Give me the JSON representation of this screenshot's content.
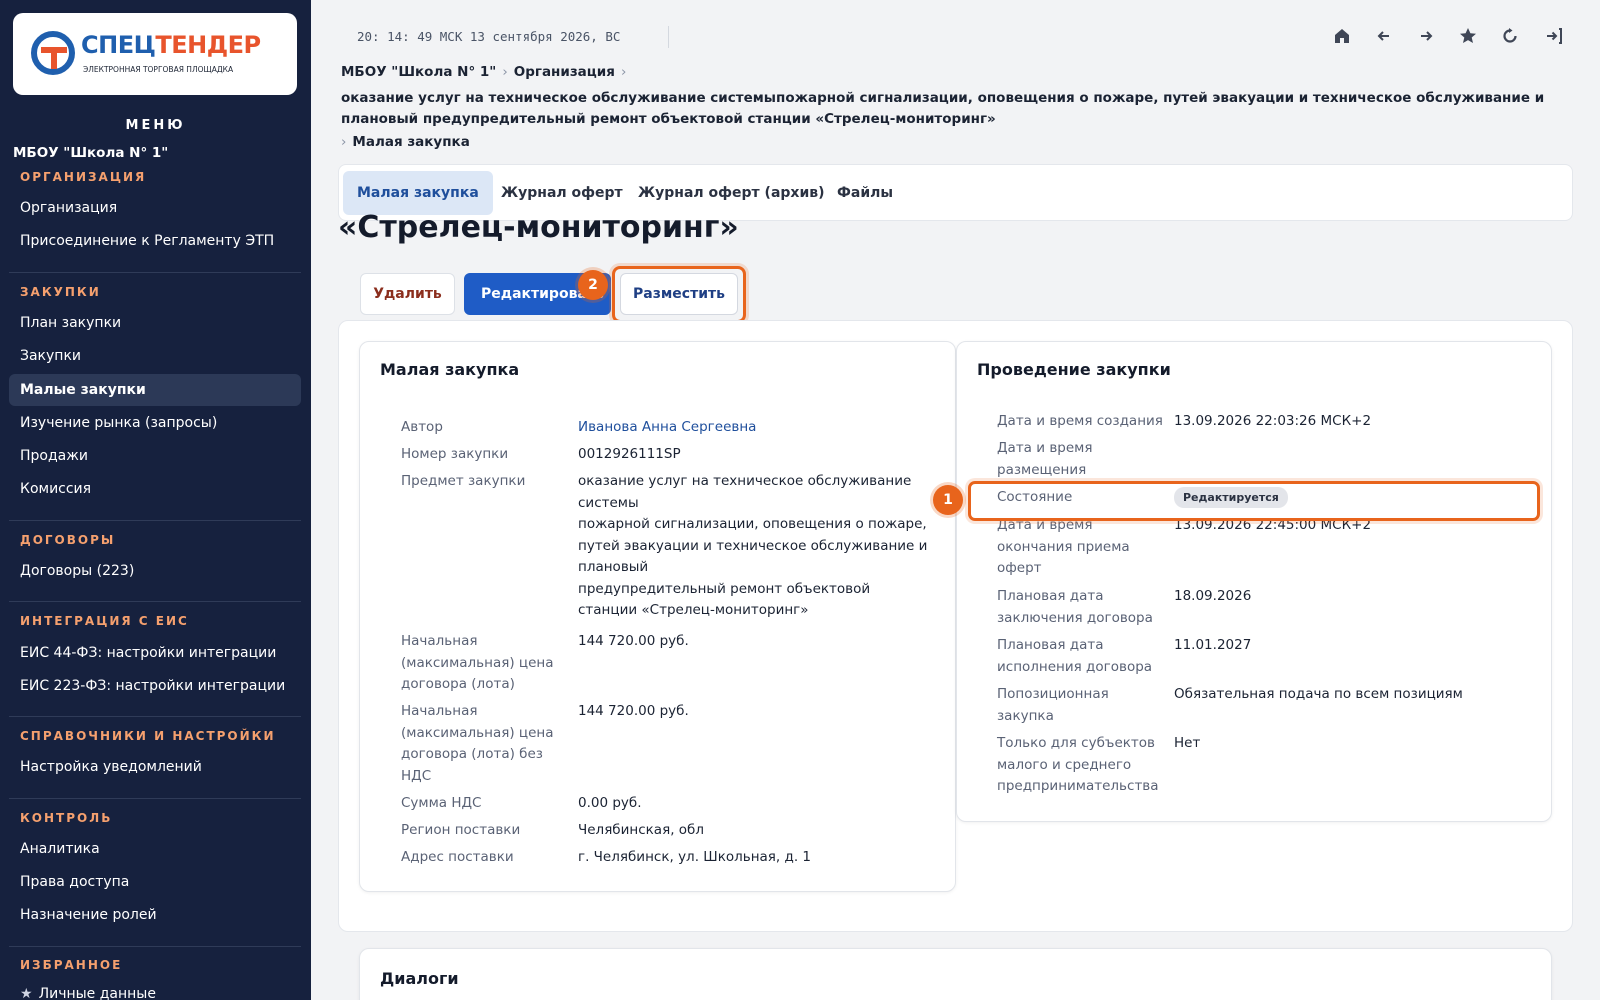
{
  "sidebar": {
    "logo": {
      "title_part1": "СПЕЦ",
      "title_part2": "ТЕНДЕР",
      "subtitle": "ЭЛЕКТРОННАЯ ТОРГОВАЯ ПЛОЩАДКА"
    },
    "menu_title": "МЕНЮ",
    "org_name": "МБОУ \"Школа N° 1\"",
    "sections": {
      "org": {
        "title": "ОРГАНИЗАЦИЯ",
        "items": [
          "Организация",
          "Присоединение к Регламенту ЭТП"
        ]
      },
      "purchases": {
        "title": "ЗАКУПКИ",
        "items": [
          "План закупки",
          "Закупки",
          "Малые закупки",
          "Изучение рынка (запросы)",
          "Продажи",
          "Комиссия"
        ]
      },
      "contracts": {
        "title": "ДОГОВОРЫ",
        "items": [
          "Договоры (223)"
        ]
      },
      "eis": {
        "title": "ИНТЕГРАЦИЯ С ЕИС",
        "items": [
          "ЕИС 44-ФЗ: настройки интеграции",
          "ЕИС 223-ФЗ: настройки интеграции"
        ]
      },
      "settings": {
        "title": "СПРАВОЧНИКИ И НАСТРОЙКИ",
        "items": [
          "Настройка уведомлений"
        ]
      },
      "control": {
        "title": "КОНТРОЛЬ",
        "items": [
          "Аналитика",
          "Права доступа",
          "Назначение ролей"
        ]
      },
      "favorites": {
        "title": "ИЗБРАННОЕ",
        "items": [
          "Личные данные"
        ]
      }
    }
  },
  "topbar": {
    "clock": "20: 14: 49 МСК  13 сентября 2026, ВС",
    "icons": {
      "home": "home-icon",
      "back": "arrow-left-icon",
      "forward": "arrow-right-icon",
      "favorite": "star-icon",
      "refresh": "refresh-icon",
      "logout": "logout-icon"
    }
  },
  "breadcrumb": {
    "org": "МБОУ \"Школа N° 1\"",
    "section": "Организация",
    "subject": "оказание услуг на техническое обслуживание системыпожарной сигнализации, оповещения о пожаре, путей эвакуации и техническое обслуживание и плановый предупредительный ремонт объектовой станции «Стрелец-мониторинг»",
    "current": "Малая закупка",
    "separator": "›"
  },
  "tabs": [
    "Малая закупка",
    "Журнал оферт",
    "Журнал оферт (архив)",
    "Файлы"
  ],
  "page_title": "«Стрелец-мониторинг»",
  "actions": {
    "delete": "Удалить",
    "edit": "Редактировать",
    "place": "Разместить"
  },
  "annotations": {
    "step1": "1",
    "step2": "2"
  },
  "purchase_panel": {
    "title": "Малая закупка",
    "rows": [
      {
        "label": "Автор",
        "value": "Иванова Анна Сергеевна"
      },
      {
        "label": "Номер закупки",
        "value": "0012926111SP"
      },
      {
        "label": "Предмет закупки",
        "value_lines": [
          "оказание услуг на техническое обслуживание",
          "системы",
          "пожарной сигнализации, оповещения о пожаре,",
          "путей эвакуации и техническое обслуживание и",
          "плановый",
          "предупредительный ремонт объектовой",
          "станции «Стрелец-мониторинг»"
        ]
      },
      {
        "label_lines": [
          "Начальная",
          "(максимальная) цена",
          "договора (лота)"
        ],
        "value": "144 720.00 руб."
      },
      {
        "label_lines": [
          "Начальная",
          "(максимальная) цена",
          "договора (лота) без",
          "НДС"
        ],
        "value": "144 720.00 руб."
      },
      {
        "label": "Сумма НДС",
        "value": "0.00 руб."
      },
      {
        "label": "Регион поставки",
        "value": "Челябинская, обл"
      },
      {
        "label": "Адрес поставки",
        "value": "г. Челябинск, ул. Школьная, д. 1"
      }
    ]
  },
  "conduct_panel": {
    "title": "Проведение закупки",
    "rows": [
      {
        "label": "Дата и время создания",
        "value": "13.09.2026 22:03:26 МСК+2"
      },
      {
        "label_lines": [
          "Дата и время",
          "размещения"
        ],
        "value": ""
      },
      {
        "label": "Состояние",
        "value": "Редактируется"
      },
      {
        "label_lines": [
          "Дата и время",
          "окончания приема",
          "оферт"
        ],
        "value": "13.09.2026 22:45:00 МСК+2"
      },
      {
        "label_lines": [
          "Плановая дата",
          "заключения договора"
        ],
        "value": "18.09.2026"
      },
      {
        "label_lines": [
          "Плановая дата",
          "исполнения договора"
        ],
        "value": "11.01.2027"
      },
      {
        "label_lines": [
          "Попозиционная",
          "закупка"
        ],
        "value": "Обязательная подача по всем позициям"
      },
      {
        "label_lines": [
          "Только для субъектов",
          "малого и среднего",
          "предпринимательства"
        ],
        "value": "Нет"
      }
    ]
  },
  "dialogs": {
    "title": "Диалоги"
  }
}
